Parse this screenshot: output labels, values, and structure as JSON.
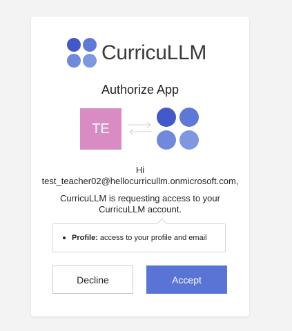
{
  "brand": {
    "name": "CurricuLLM",
    "colors": [
      "#4358c9",
      "#5e78d8",
      "#6f89dc",
      "#7f97e1"
    ]
  },
  "dialog": {
    "title": "Authorize App",
    "user": {
      "initials": "TE",
      "avatar_color": "#d98bc3"
    },
    "greeting_line1": "Hi",
    "greeting_line2": "test_teacher02@hellocurricullm.onmicrosoft.com,",
    "request_line1": "CurricuLLM is requesting access to your",
    "request_line2": "CurricuLLM account.",
    "permissions": [
      {
        "name": "Profile:",
        "description": "access to your profile and email"
      }
    ],
    "decline_label": "Decline",
    "accept_label": "Accept",
    "accept_color": "#5a74d6"
  }
}
